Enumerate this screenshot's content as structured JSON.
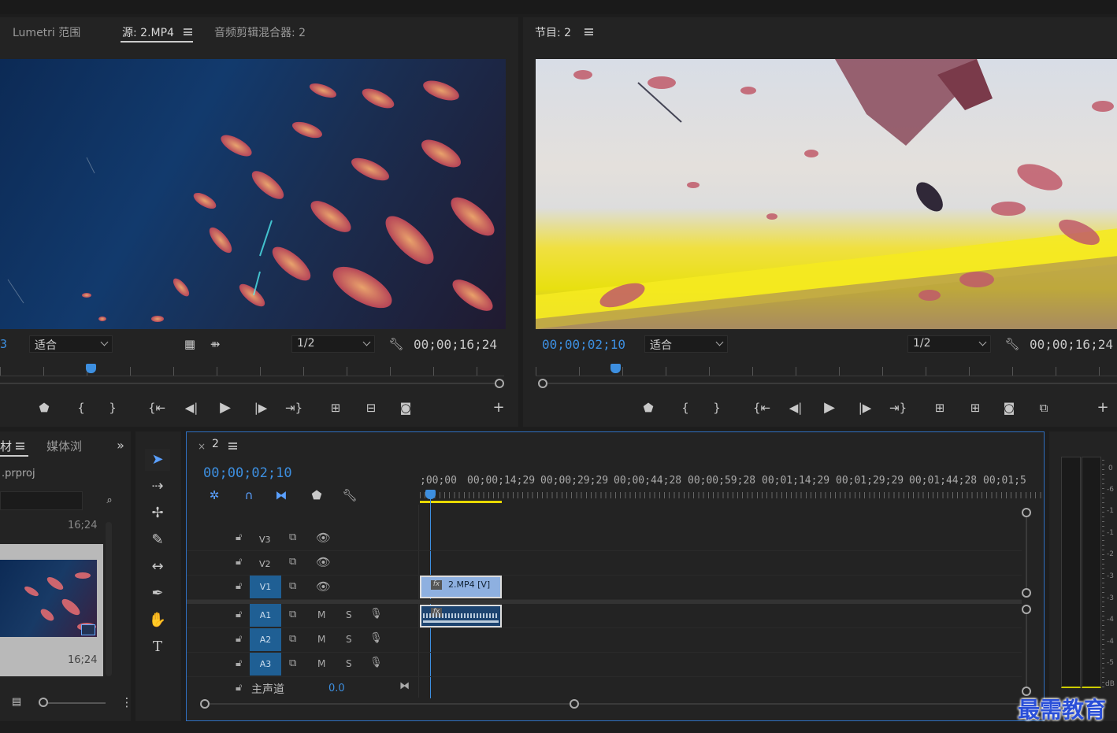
{
  "source_panel": {
    "tabs": [
      {
        "label": "Lumetri 范围"
      },
      {
        "label": "源: 2.MP4"
      },
      {
        "label": "音频剪辑混合器: 2"
      }
    ],
    "left_timecode_fragment": "3",
    "fit_label": "适合",
    "resolution": "1/2",
    "duration": "00;00;16;24"
  },
  "program_panel": {
    "tab_label": "节目: 2",
    "current_time": "00;00;02;10",
    "fit_label": "适合",
    "resolution": "1/2",
    "duration": "00;00;16;24"
  },
  "project_panel": {
    "tab_label": "材",
    "tab2_label": "媒体浏",
    "project_file": ".prproj",
    "thumb_top_duration": "16;24",
    "thumb_duration": "16;24"
  },
  "timeline": {
    "sequence_name": "2",
    "current_time": "00;00;02;10",
    "ruler_labels": [
      ";00;00",
      "00;00;14;29",
      "00;00;29;29",
      "00;00;44;28",
      "00;00;59;28",
      "00;01;14;29",
      "00;01;29;29",
      "00;01;44;28",
      "00;01;5"
    ],
    "video_tracks": [
      {
        "name": "V3",
        "target": false
      },
      {
        "name": "V2",
        "target": false
      },
      {
        "name": "V1",
        "target": true
      }
    ],
    "audio_tracks": [
      {
        "name": "A1",
        "m": "M",
        "s": "S"
      },
      {
        "name": "A2",
        "m": "M",
        "s": "S"
      },
      {
        "name": "A3",
        "m": "M",
        "s": "S"
      }
    ],
    "master_label": "主声道",
    "master_value": "0.0",
    "video_clip_label": "2.MP4 [V]",
    "fx_label": "fx"
  },
  "meter_labels": [
    "0",
    "-6",
    "-1",
    "-1",
    "-2",
    "-3",
    "-3",
    "-4",
    "-4",
    "-5",
    "dB"
  ],
  "watermark": "最需教育",
  "colors": {
    "accent_blue": "#3d8fe0",
    "track_blue": "#1f5f94",
    "clip_blue": "#8eb0e0",
    "work_area_yellow": "#e8d800"
  }
}
